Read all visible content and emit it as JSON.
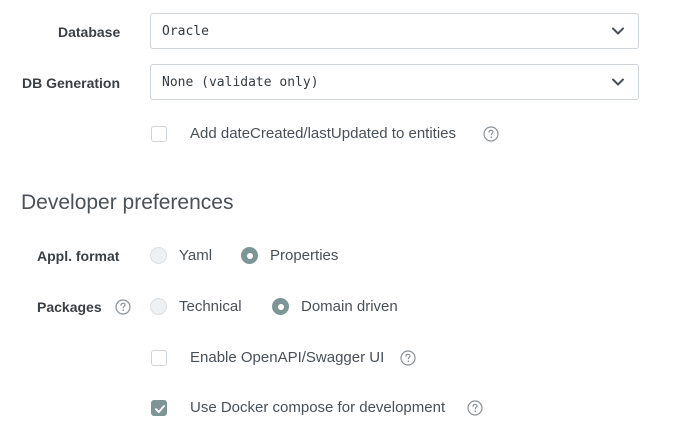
{
  "database": {
    "label": "Database",
    "selected": "Oracle"
  },
  "db_generation": {
    "label": "DB Generation",
    "selected": "None (validate only)"
  },
  "date_created_option": {
    "label": "Add dateCreated/lastUpdated to entities",
    "checked": false
  },
  "developer_preferences": {
    "title": "Developer preferences"
  },
  "appl_format": {
    "label": "Appl. format",
    "options": [
      {
        "label": "Yaml",
        "checked": false
      },
      {
        "label": "Properties",
        "checked": true
      }
    ]
  },
  "packages": {
    "label": "Packages",
    "options": [
      {
        "label": "Technical",
        "checked": false
      },
      {
        "label": "Domain driven",
        "checked": true
      }
    ]
  },
  "openapi_option": {
    "label": "Enable OpenAPI/Swagger UI",
    "checked": false
  },
  "docker_option": {
    "label": "Use Docker compose for development",
    "checked": true
  },
  "icons": {
    "dropdown": "chevron-down-icon",
    "help": "question-circle-icon",
    "check": "checkmark-icon"
  },
  "colors": {
    "accent": "#7e9595",
    "border": "#cfd4d9",
    "text": "#495057"
  }
}
